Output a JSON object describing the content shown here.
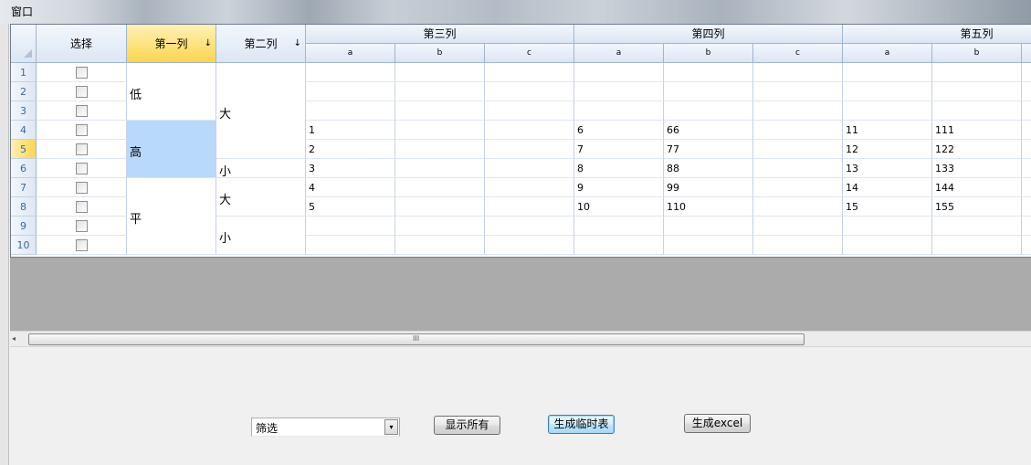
{
  "window": {
    "title": "窗口"
  },
  "grid": {
    "select_header": "选择",
    "col1_header": "第一列",
    "col2_header": "第二列",
    "sort_glyph": "↓",
    "group_headers": [
      "第三列",
      "第四列",
      "第五列"
    ],
    "sub_headers": [
      "a",
      "b",
      "c",
      "a",
      "b",
      "c",
      "a",
      "b"
    ],
    "row_numbers": [
      "1",
      "2",
      "3",
      "4",
      "5",
      "6",
      "7",
      "8",
      "9",
      "10"
    ],
    "selected_row": "5",
    "col1_groups": [
      {
        "label": "低",
        "rows": [
          1,
          3
        ]
      },
      {
        "label": "高",
        "rows": [
          4,
          6
        ],
        "highlight": true
      },
      {
        "label": "平",
        "rows": [
          7,
          10
        ]
      }
    ],
    "col2_groups": [
      {
        "label": "大",
        "rows": [
          1,
          5
        ]
      },
      {
        "label": "小",
        "rows": [
          6,
          6
        ]
      },
      {
        "label": "大",
        "rows": [
          7,
          8
        ]
      },
      {
        "label": "小",
        "rows": [
          9,
          10
        ]
      }
    ],
    "rows": [
      {
        "row": 4,
        "g3a": "1",
        "g4a": "6",
        "g4b": "66",
        "g5a": "11",
        "g5b": "111"
      },
      {
        "row": 5,
        "g3a": "2",
        "g4a": "7",
        "g4b": "77",
        "g5a": "12",
        "g5b": "122"
      },
      {
        "row": 6,
        "g3a": "3",
        "g4a": "8",
        "g4b": "88",
        "g5a": "13",
        "g5b": "133"
      },
      {
        "row": 7,
        "g3a": "4",
        "g4a": "9",
        "g4b": "99",
        "g5a": "14",
        "g5b": "144"
      },
      {
        "row": 8,
        "g3a": "5",
        "g4a": "10",
        "g4b": "110",
        "g5a": "15",
        "g5b": "155"
      }
    ]
  },
  "scrollbar": {
    "left_arrow": "◂",
    "grip": "III"
  },
  "controls": {
    "filter_value": "筛选",
    "dropdown_glyph": "▾",
    "show_all_label": "显示所有",
    "temp_table_label": "生成临时表",
    "excel_label": "生成excel"
  },
  "colors": {
    "selected_header": "#ffd54e",
    "highlight_cell": "#b9d9fb",
    "grid_line": "#c5d2e3"
  }
}
